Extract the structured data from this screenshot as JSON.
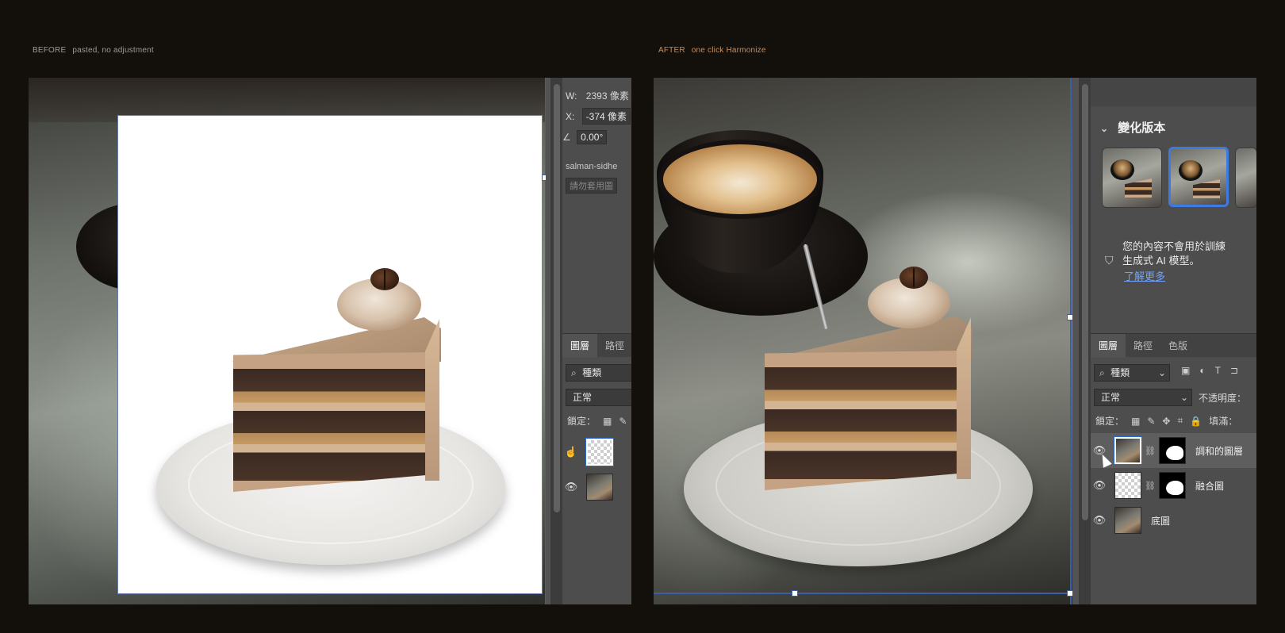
{
  "before_caption": {
    "tag": "BEFORE",
    "desc": "pasted, no adjustment"
  },
  "after_caption": {
    "tag": "AFTER",
    "desc": "one click Harmonize"
  },
  "left_panel": {
    "width_label": "W:",
    "width_value": "2393 像素",
    "x_label": "X:",
    "x_value": "-374 像素",
    "angle_value": "0.00°",
    "credit_name": "salman-sidhe",
    "credit_hint": "請勿套用圖",
    "tabs": [
      "圖層",
      "路徑"
    ],
    "kind_filter": "種類",
    "blend_mode": "正常",
    "lock_label": "鎖定："
  },
  "right_panel": {
    "variations_title": "變化版本",
    "notice_line1": "您的內容不會用於訓練",
    "notice_line2": "生成式 AI 模型。",
    "learn_more": "了解更多",
    "tabs": [
      "圖層",
      "路徑",
      "色版"
    ],
    "kind_filter": "種類",
    "blend_mode": "正常",
    "opacity_label": "不透明度：",
    "lock_label": "鎖定：",
    "fill_label": "填滿：",
    "layers": [
      {
        "name": "調和的圖層",
        "type": "photo-with-mask",
        "selected": true
      },
      {
        "name": "融合圖",
        "type": "transparent-with-mask",
        "selected": false
      },
      {
        "name": "底圖",
        "type": "photo",
        "selected": false
      }
    ]
  },
  "icons": {
    "search": "search-icon",
    "eye": "eye-icon",
    "link": "link-icon",
    "chevron": "chevron-down-icon",
    "shield": "shield-icon",
    "lock": "lock-icon",
    "brush": "brush-icon",
    "move": "move-icon",
    "crop": "artboard-icon",
    "checker": "transparency-lock-icon",
    "image_filter": "image-filter-icon",
    "adjust_filter": "adjustment-filter-icon",
    "text_filter": "text-filter-icon",
    "angle": "angle-icon",
    "hand": "hand-cursor-icon",
    "arrow": "arrow-cursor-icon"
  },
  "colors": {
    "selection": "#3a5ea8",
    "link": "#6fa3ff",
    "variant_selected": "#3d7be0"
  }
}
